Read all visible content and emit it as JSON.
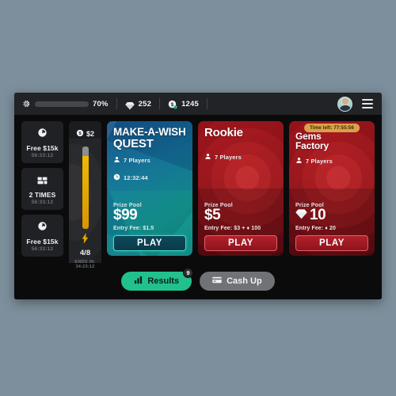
{
  "topbar": {
    "gear_icon": "gear-icon",
    "xp_percent_label": "70%",
    "xp_percent_value": 70,
    "gem_icon": "gem-icon",
    "gem_count": "252",
    "coin_icon": "coin-icon",
    "coin_count": "1245",
    "avatar": "user-avatar",
    "menu_icon": "hamburger-menu-icon"
  },
  "mini_cards": [
    {
      "icon": "clock-icon",
      "title": "Free $15k",
      "timer": "56:33:12"
    },
    {
      "icon": "grid-icon",
      "title": "2 TIMES",
      "timer": "56:33:12"
    },
    {
      "icon": "clock-icon",
      "title": "Free $15k",
      "timer": "56:33:12"
    }
  ],
  "energy": {
    "coin_icon": "dollar-coin-icon",
    "amount": "$2",
    "fill_percent": 88,
    "bolt_icon": "lightning-bolt-icon",
    "count": "4/8",
    "ends_label": "ENDS IN:",
    "ends_time": "34:23:12"
  },
  "cards": [
    {
      "theme": "teal",
      "title_line1": "MAKE-A-WISH",
      "title_line2": "QUEST",
      "players_icon": "person-icon",
      "players": "7 Players",
      "timer_icon": "clock-icon",
      "timer": "12:32:44",
      "prize_label": "Prize Pool",
      "prize_value": "$99",
      "prize_icon": "",
      "entry_fee": "Entry Fee: $1.5",
      "play_label": "PLAY",
      "time_left_badge": ""
    },
    {
      "theme": "red",
      "title_line1": "Rookie",
      "title_line2": "",
      "players_icon": "person-icon",
      "players": "7 Players",
      "timer_icon": "",
      "timer": "",
      "prize_label": "Prize Pool",
      "prize_value": "$5",
      "prize_icon": "",
      "entry_fee": "Entry Fee: $3 + ♦ 100",
      "play_label": "PLAY",
      "time_left_badge": ""
    },
    {
      "theme": "red",
      "title_line1": "Gems",
      "title_line2": "Factory",
      "players_icon": "person-icon",
      "players": "7 Players",
      "timer_icon": "",
      "timer": "",
      "prize_label": "Prize Pool",
      "prize_value": "10",
      "prize_icon": "gem-icon",
      "entry_fee": "Entry Fee: ♦ 20",
      "play_label": "PLAY",
      "time_left_badge": "Time left: 77:55:56"
    }
  ],
  "bottom": {
    "results_icon": "bar-chart-icon",
    "results_label": "Results",
    "results_badge": "9",
    "cash_icon": "card-icon",
    "cash_label": "Cash Up"
  },
  "colors": {
    "page_background": "#7d8f9c",
    "app_background": "#0b0b0c",
    "topbar": "#222326",
    "accent_teal": "#2fd39a",
    "accent_red": "#b3212b",
    "accent_gold": "#d9a14a",
    "energy_yellow": "#e3a400"
  }
}
